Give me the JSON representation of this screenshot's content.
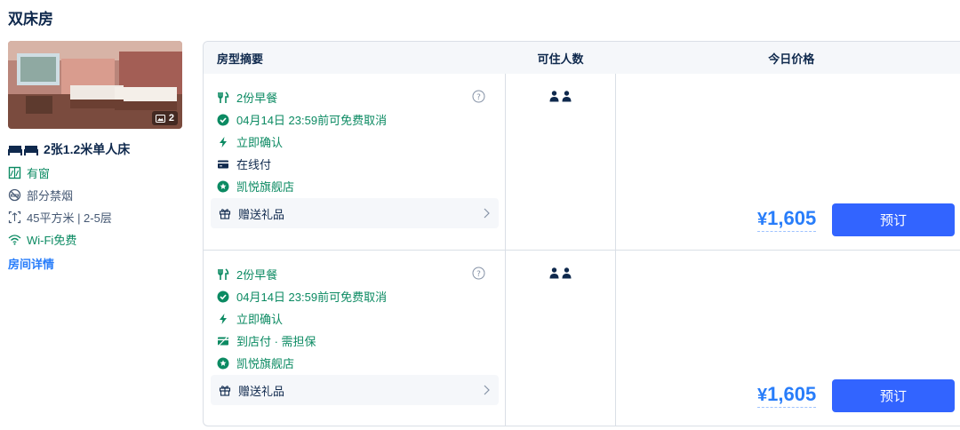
{
  "room": {
    "title": "双床房",
    "photo_count": "2",
    "bed": "2张1.2米单人床",
    "facilities": [
      {
        "icon": "window-icon",
        "label": "有窗",
        "color": "#0b8a62"
      },
      {
        "icon": "no-smoking-icon",
        "label": "部分禁烟",
        "color": "#455873"
      },
      {
        "icon": "area-icon",
        "label": "45平方米 | 2-5层",
        "color": "#455873"
      },
      {
        "icon": "wifi-icon",
        "label": "Wi-Fi免费",
        "color": "#0b8a62"
      }
    ],
    "detail_link": "房间详情"
  },
  "table": {
    "headers": {
      "summary": "房型摘要",
      "guests": "可住人数",
      "price": "今日价格"
    }
  },
  "offers": [
    {
      "breakfast": "2份早餐",
      "cancel": "04月14日 23:59前可免费取消",
      "confirm": "立即确认",
      "payment": "在线付",
      "store": "凯悦旗舰店",
      "gift": "赠送礼品",
      "price_symbol": "¥",
      "price": "1,605",
      "book": "预订"
    },
    {
      "breakfast": "2份早餐",
      "cancel": "04月14日 23:59前可免费取消",
      "confirm": "立即确认",
      "payment": "到店付 · 需担保",
      "store": "凯悦旗舰店",
      "gift": "赠送礼品",
      "price_symbol": "¥",
      "price": "1,605",
      "book": "预订"
    }
  ],
  "colors": {
    "accent": "#287dfa",
    "button": "#3264ff",
    "green": "#0b8a62",
    "text": "#0f294d"
  }
}
